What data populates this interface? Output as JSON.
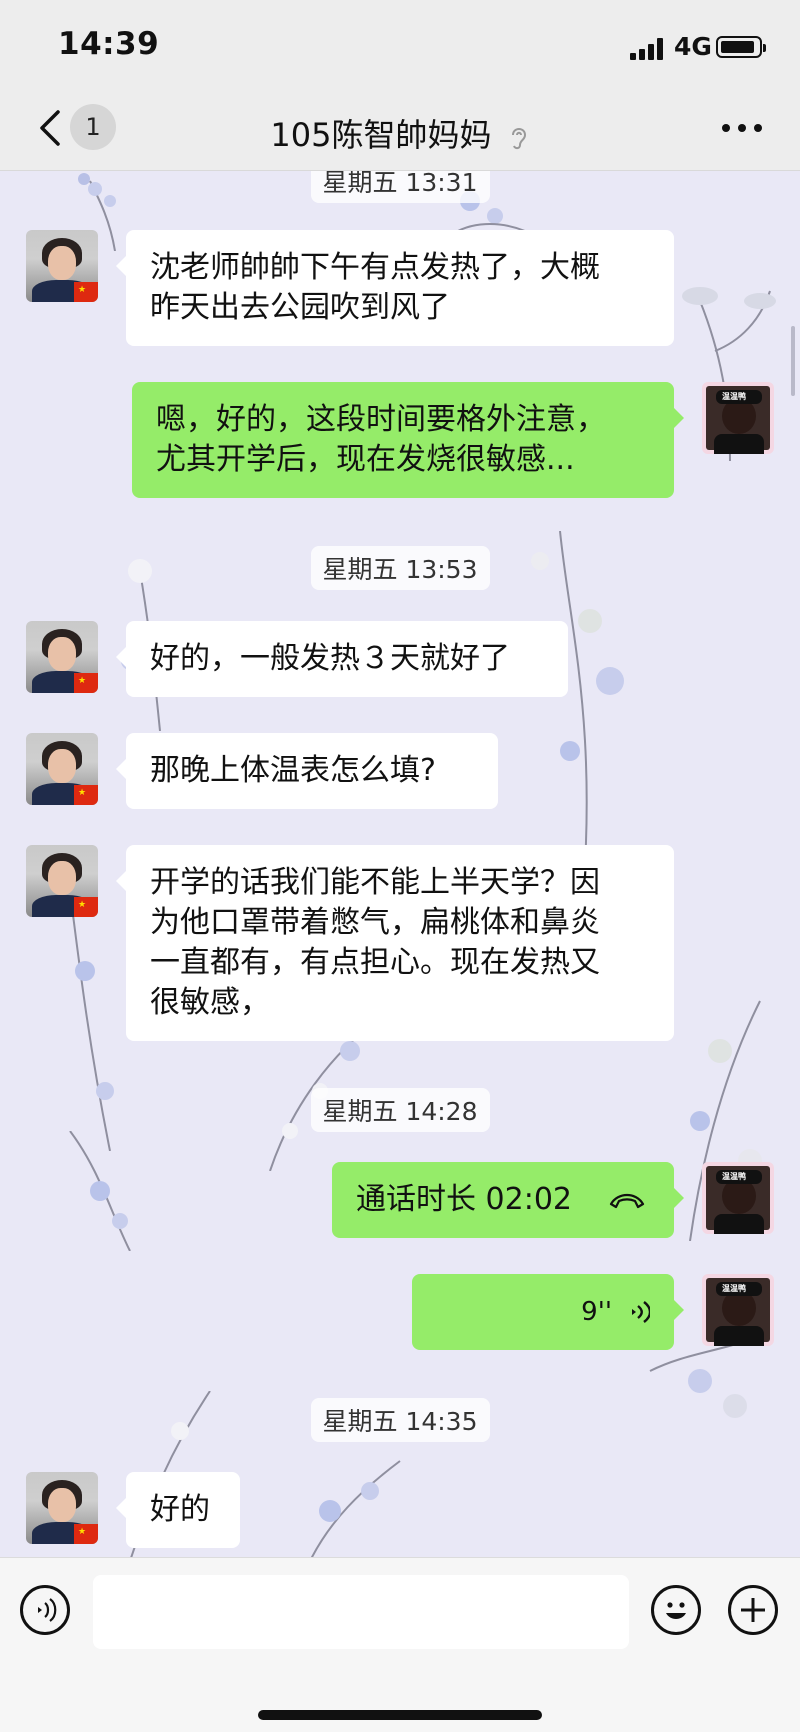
{
  "status_bar": {
    "time": "14:39",
    "network": "4G"
  },
  "nav": {
    "unread_count": "1",
    "title": "105陈智帥妈妈",
    "back_icon": "chevron-left-icon",
    "ear_icon": "earpiece-icon",
    "more_icon": "more-dots-icon"
  },
  "messages": [
    {
      "type": "timestamp",
      "text": "星期五 13:31"
    },
    {
      "type": "incoming",
      "lines": [
        "沈老师帥帥下午有点发热了，大概",
        "昨天出去公园吹到风了"
      ]
    },
    {
      "type": "outgoing",
      "lines": [
        "嗯，好的，这段时间要格外注意，",
        "尤其开学后，现在发烧很敏感..."
      ]
    },
    {
      "type": "timestamp",
      "text": "星期五 13:53"
    },
    {
      "type": "incoming",
      "lines": [
        "好的，一般发热３天就好了"
      ]
    },
    {
      "type": "incoming",
      "lines": [
        "那晚上体温表怎么填?"
      ]
    },
    {
      "type": "incoming",
      "lines": [
        "开学的话我们能不能上半天学？因",
        "为他口罩带着憋气，扁桃体和鼻炎",
        "一直都有，有点担心。现在发热又",
        "很敏感，"
      ]
    },
    {
      "type": "timestamp",
      "text": "星期五 14:28"
    },
    {
      "type": "outgoing_call",
      "text": "通话时长 02:02",
      "icon": "phone-hangup-icon"
    },
    {
      "type": "outgoing_voice",
      "text": "9''",
      "icon": "voice-waves-icon"
    },
    {
      "type": "timestamp",
      "text": "星期五 14:35"
    },
    {
      "type": "incoming",
      "lines": [
        "好的"
      ]
    }
  ],
  "input_bar": {
    "voice_icon": "voice-input-icon",
    "emoji_icon": "emoji-icon",
    "plus_icon": "plus-icon"
  },
  "colors": {
    "outgoing_bubble": "#95ec69",
    "incoming_bubble": "#ffffff",
    "chat_background": "#e9e8f6"
  }
}
